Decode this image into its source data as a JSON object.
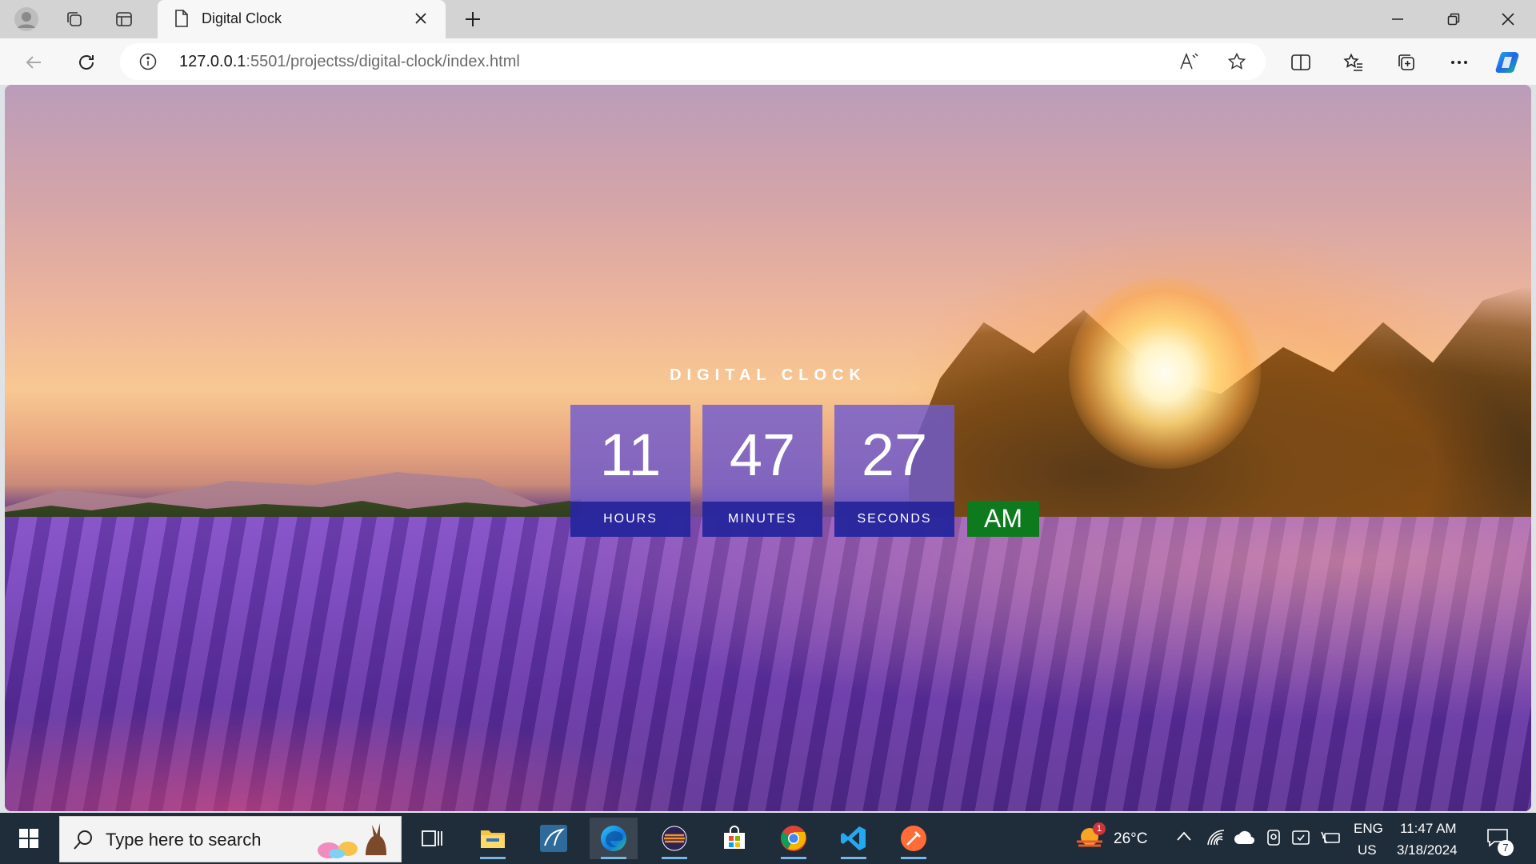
{
  "browser": {
    "tab_title": "Digital Clock",
    "url_host": "127.0.0.1",
    "url_rest": ":5501/projectss/digital-clock/index.html"
  },
  "page": {
    "title": "DIGITAL CLOCK",
    "hours": "11",
    "minutes": "47",
    "seconds": "27",
    "hours_label": "HOURS",
    "minutes_label": "MINUTES",
    "seconds_label": "SECONDS",
    "ampm": "AM"
  },
  "taskbar": {
    "search_placeholder": "Type here to search",
    "weather_temp": "26°C",
    "weather_badge": "1",
    "lang_line1": "ENG",
    "lang_line2": "US",
    "time": "11:47 AM",
    "date": "3/18/2024",
    "notification_count": "7"
  }
}
